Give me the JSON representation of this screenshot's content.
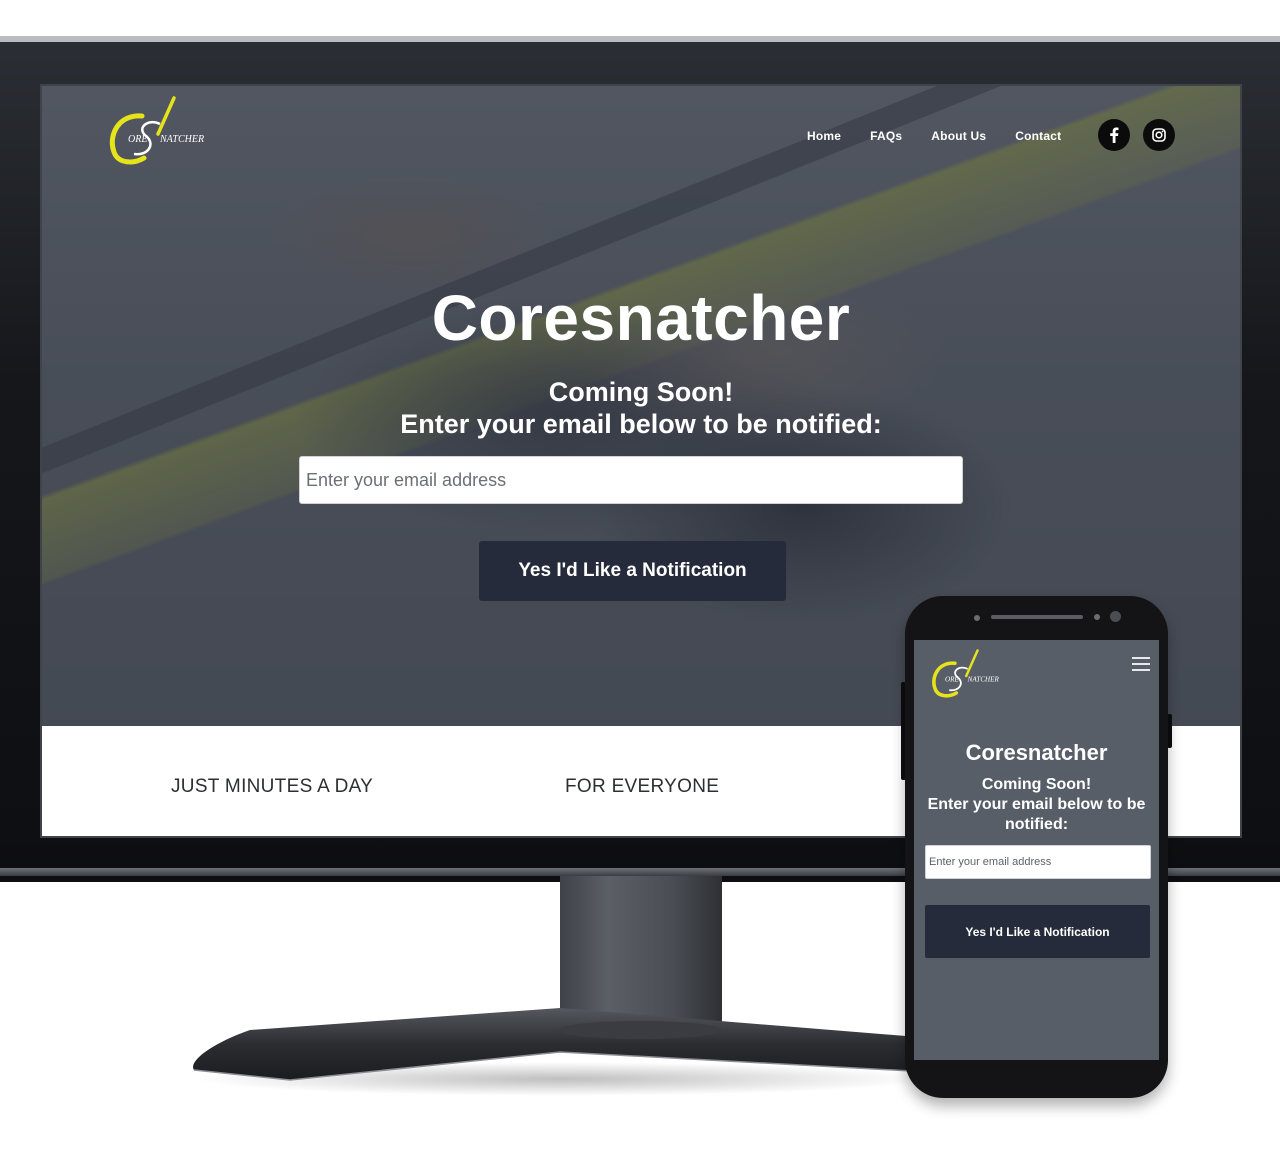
{
  "desktop": {
    "brand": {
      "logo_icon": "coresnatcher-logo",
      "letter_c": "C",
      "letter_s": "S",
      "word_ore": "ORE",
      "word_natcher": "NATCHER",
      "accent_color": "#e5e31b"
    },
    "nav": {
      "items": [
        {
          "label": "Home"
        },
        {
          "label": "FAQs"
        },
        {
          "label": "About Us"
        },
        {
          "label": "Contact"
        }
      ]
    },
    "social": [
      {
        "icon": "facebook-icon"
      },
      {
        "icon": "instagram-icon"
      }
    ],
    "hero": {
      "title": "Coresnatcher",
      "line1": "Coming Soon!",
      "line2": "Enter your email below to be notified:",
      "email_placeholder": "Enter your email address",
      "email_value": "",
      "cta_label": "Yes I'd Like a Notification",
      "cta_color": "#252b3a"
    },
    "features": [
      {
        "label": "JUST MINUTES A DAY"
      },
      {
        "label": "FOR EVERYONE"
      }
    ]
  },
  "mobile": {
    "menu_icon": "hamburger-menu-icon",
    "title": "Coresnatcher",
    "line1": "Coming Soon!",
    "line2": "Enter your email below to be notified:",
    "email_placeholder": "Enter your email address",
    "email_value": "",
    "cta_label": "Yes I'd Like a Notification"
  }
}
